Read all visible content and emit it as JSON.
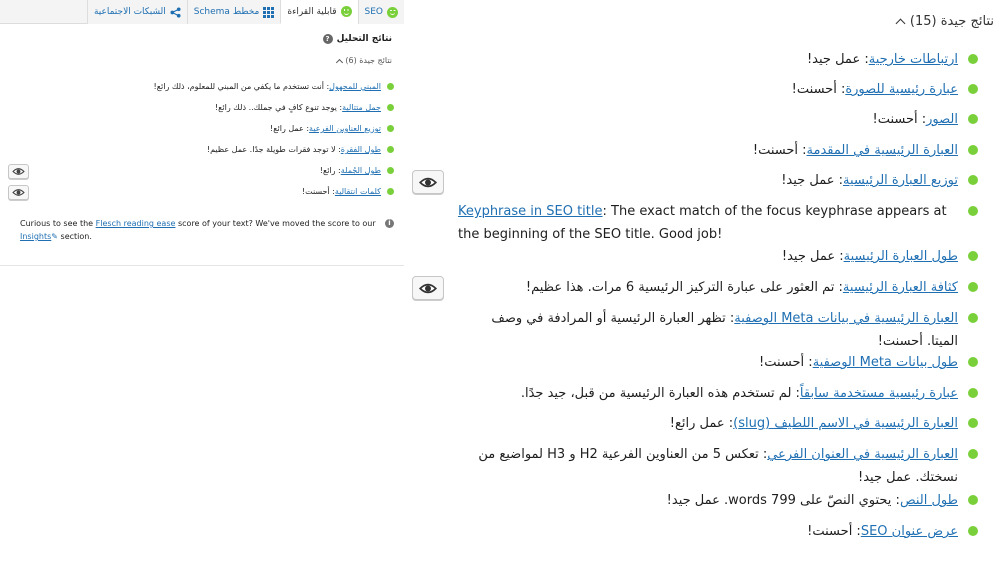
{
  "left": {
    "tabs": [
      {
        "label": "SEO",
        "icon": "smiley-face-icon"
      },
      {
        "label": "قابلية القراءة",
        "icon": "smiley-face-icon"
      },
      {
        "label": "مخطط Schema",
        "icon": "grid-icon"
      },
      {
        "label": "الشبكات الاجتماعية",
        "icon": "share-icon"
      }
    ],
    "analysis_title": "نتائج التحليل",
    "group_label": "نتائج جيدة (6)",
    "results": [
      {
        "link": "المبني للمجهول",
        "text": ": أنت تستخدم ما يكفي من المبني للمعلوم، ذلك رائع!"
      },
      {
        "link": "جمل متتالية",
        "text": ": يوجد تنوع كافٍ في جملك.. ذلك رائع!"
      },
      {
        "link": "توزيع العناوين الفرعية",
        "text": ": عمل رائع!"
      },
      {
        "link": "طول الفقرة",
        "text": ": لا توجد فقرات طويلة جدًا. عمل عظيم!"
      },
      {
        "link": "طول الجُملة",
        "text": ": رائع!"
      },
      {
        "link": "كلمات انتقالية",
        "text": ": أحسنت!"
      }
    ],
    "info": {
      "before_link": "Curious to see the ",
      "link": "Flesch reading ease",
      "after_link": " score of your text? We've moved the score to our",
      "link2": "Insights",
      "end": " section."
    }
  },
  "right": {
    "group_label": "نتائج جيدة (15)",
    "results": [
      {
        "link": "ارتباطات خارجية",
        "text": ": عمل جيد!"
      },
      {
        "link": "عبارة رئيسية للصورة",
        "text": ": أحسنت!"
      },
      {
        "link": "الصور",
        "text": ": أحسنت!"
      },
      {
        "link": "العبارة الرئيسية في المقدمة",
        "text": ": أحسنت!"
      },
      {
        "link": "توزيع العبارة الرئيسية",
        "text": ": عمل جيد!"
      },
      {
        "link": "Keyphrase in SEO title",
        "text": ": The exact match of the focus keyphrase appears at the beginning of the SEO title. Good job!"
      },
      {
        "link": "طول العبارة الرئيسية",
        "text": ": عمل جيد!"
      },
      {
        "link": "كثافة العبارة الرئيسية",
        "text": ": تم العثور على عبارة التركيز الرئيسية 6 مرات. هذا عظيم!"
      },
      {
        "link": "العبارة الرئيسية في بيانات Meta الوصفية",
        "text": ": تظهر العبارة الرئيسية أو المرادفة في وصف الميتا. أحسنت!"
      },
      {
        "link": "طول بيانات Meta الوصفية",
        "text": ": أحسنت!"
      },
      {
        "link": "عبارة رئيسية مستخدمة سابقاً",
        "text": ": لم تستخدم هذه العبارة الرئيسية من قبل، جيد جدًا."
      },
      {
        "link": "العبارة الرئيسية في الاسم اللطيف (slug)",
        "text": ": عمل رائع!"
      },
      {
        "link": "العبارة الرئيسية في العنوان الفرعي",
        "text": ": تعكس 5 من العناوين الفرعية H2 و H3 لمواضيع من نسختك. عمل جيد!"
      },
      {
        "link": "طول النص",
        "text": ": يحتوي النصّ على 799 words. عمل جيد!"
      },
      {
        "link": "عرض عنوان SEO",
        "text": ": أحسنت!"
      }
    ]
  }
}
